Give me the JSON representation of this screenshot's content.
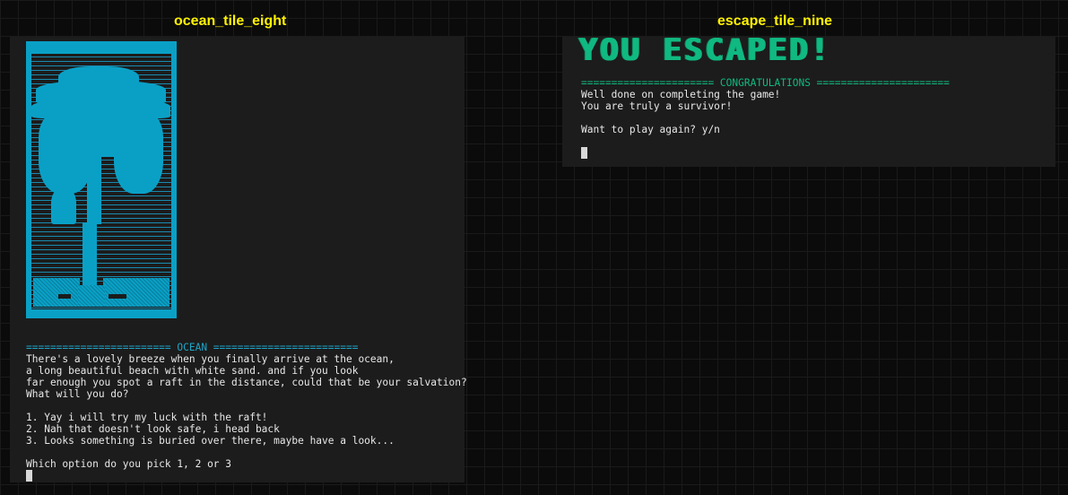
{
  "tiles": {
    "left": {
      "title": "ocean_tile_eight",
      "separator": "======================== OCEAN ========================",
      "lines": [
        "There's a lovely breeze when you finally arrive at the ocean,",
        "a long beautiful beach with white sand. and if you look",
        "far enough you spot a raft in the distance, could that be your salvation?",
        "What will you do?",
        "",
        "1. Yay i will try my luck with the raft!",
        "2. Nah that doesn't look safe, i head back",
        "3. Looks something is buried over there, maybe have a look...",
        "",
        "Which option do you pick 1, 2 or 3"
      ]
    },
    "right": {
      "title": "escape_tile_nine",
      "banner": "YOU ESCAPED!",
      "separator": "====================== CONGRATULATIONS ======================",
      "lines": [
        "Well done on completing the game!",
        "You are truly a survivor!",
        "",
        "Want to play again? y/n"
      ]
    }
  },
  "colors": {
    "title": "#fff200",
    "ocean_accent": "#0aa0c6",
    "escape_accent": "#10b981",
    "terminal_bg": "#1c1c1c"
  },
  "icons": {
    "palm_tree_art": "palm-tree-ascii-art",
    "cursor": "block-cursor"
  }
}
